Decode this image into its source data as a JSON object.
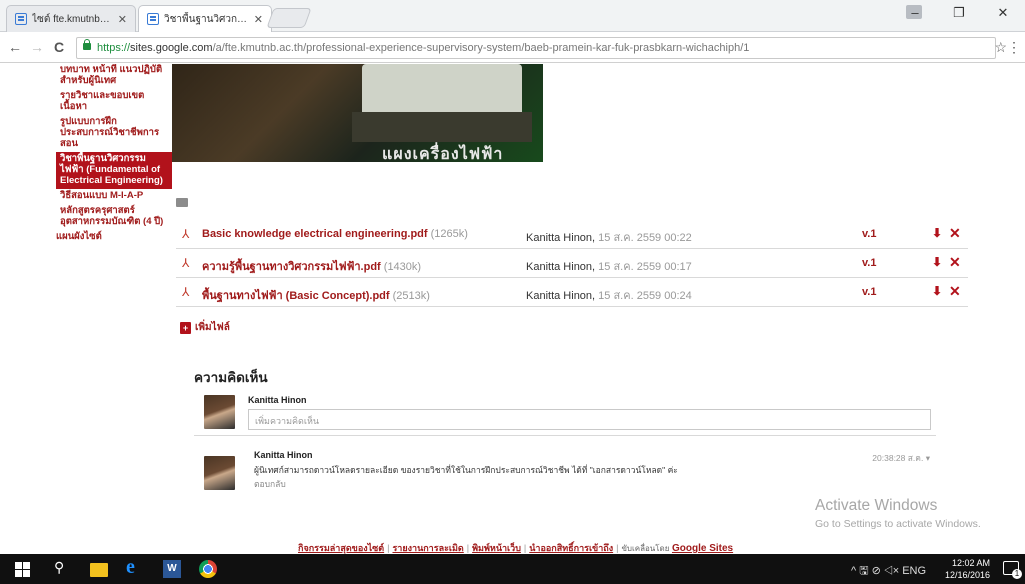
{
  "browser": {
    "tabs": [
      {
        "title": "ไซต์ fte.kmutnb.ac.th - Go",
        "active": false
      },
      {
        "title": "วิชาพื้นฐานวิศวกรรมไฟฟ้า (F",
        "active": true
      }
    ],
    "url_scheme": "https://",
    "url_host": "sites.google.com",
    "url_path": "/a/fte.kmutnb.ac.th/professional-experience-supervisory-system/baeb-pramein-kar-fuk-prasbkarn-wichachiph/1",
    "back_glyph": "←",
    "forward_glyph": "→",
    "reload_glyph": "C",
    "star_glyph": "☆",
    "menu_glyph": "⋮",
    "minimize_glyph": "–",
    "maximize_glyph": "❐",
    "close_glyph": "✕"
  },
  "sidebar": {
    "items": [
      {
        "label": "บทบาท หน้าที่ แนวปฏิบัติสำหรับผู้นิเทศ",
        "selected": false,
        "level": "sub"
      },
      {
        "label": "รายวิชาและขอบเขตเนื้อหา",
        "selected": false,
        "level": "sub"
      },
      {
        "label": "รูปแบบการฝึกประสบการณ์วิชาชีพการสอน",
        "selected": false,
        "level": "sub"
      },
      {
        "label": "วิชาพื้นฐานวิศวกรรมไฟฟ้า (Fundamental of Electrical Engineering)",
        "selected": true,
        "level": "sub"
      },
      {
        "label": "วิธีสอนแบบ M-I-A-P",
        "selected": false,
        "level": "sub"
      },
      {
        "label": "หลักสูตรครุศาสตร์อุตสาหกรรมบัณฑิต (4 ปี)",
        "selected": false,
        "level": "sub"
      },
      {
        "label": "แผนผังไซต์",
        "selected": false,
        "level": "top"
      }
    ]
  },
  "hero": {
    "caption": "แผงเครื่องไฟฟ้า"
  },
  "files": [
    {
      "name": "Basic knowledge electrical engineering.pdf",
      "size": "(1265k)",
      "user": "Kanitta Hinon,",
      "date": "15 ส.ค. 2559 00:22",
      "version": "v.1"
    },
    {
      "name": "ความรู้พื้นฐานทางวิศวกรรมไฟฟ้า.pdf",
      "size": "(1430k)",
      "user": "Kanitta Hinon,",
      "date": "15 ส.ค. 2559 00:17",
      "version": "v.1"
    },
    {
      "name": "พื้นฐานทางไฟฟ้า (Basic Concept).pdf",
      "size": "(2513k)",
      "user": "Kanitta Hinon,",
      "date": "15 ส.ค. 2559 00:24",
      "version": "v.1"
    }
  ],
  "add_file_label": "เพิ่มไฟล์",
  "comments": {
    "heading": "ความคิดเห็น",
    "current_user": "Kanitta Hinon",
    "input_placeholder": "เพิ่มความคิดเห็น",
    "items": [
      {
        "author": "Kanitta Hinon",
        "text": "ผู้นิเทศก์สามารถดาวน์โหลดรายละเอียด ของรายวิชาที่ใช้ในการฝึกประสบการณ์วิชาชีพ ได้ที่ \"เอกสารดาวน์โหลด\" ค่ะ",
        "reply_label": "ตอบกลับ",
        "time": "20:38:28 ส.ค.",
        "menu_glyph": "▾"
      }
    ]
  },
  "footer": {
    "links": [
      "กิจกรรมล่าสุดของไซต์",
      "รายงานการละเมิด",
      "พิมพ์หน้าเว็บ",
      "นำออกสิทธิ์การเข้าถึง"
    ],
    "powered_by": "ขับเคลื่อนโดย",
    "google_sites": "Google Sites"
  },
  "watermark": {
    "line1": "Activate Windows",
    "line2": "Go to Settings to activate Windows."
  },
  "taskbar": {
    "time": "12:02 AM",
    "date": "12/16/2016",
    "lang": "ENG",
    "tray_glyphs": "^ 🖫 ⊘ ◁× ",
    "notification_count": "1",
    "search_glyph": "⚲"
  },
  "colors": {
    "accent": "#b2121b",
    "link": "#a01b1b"
  }
}
